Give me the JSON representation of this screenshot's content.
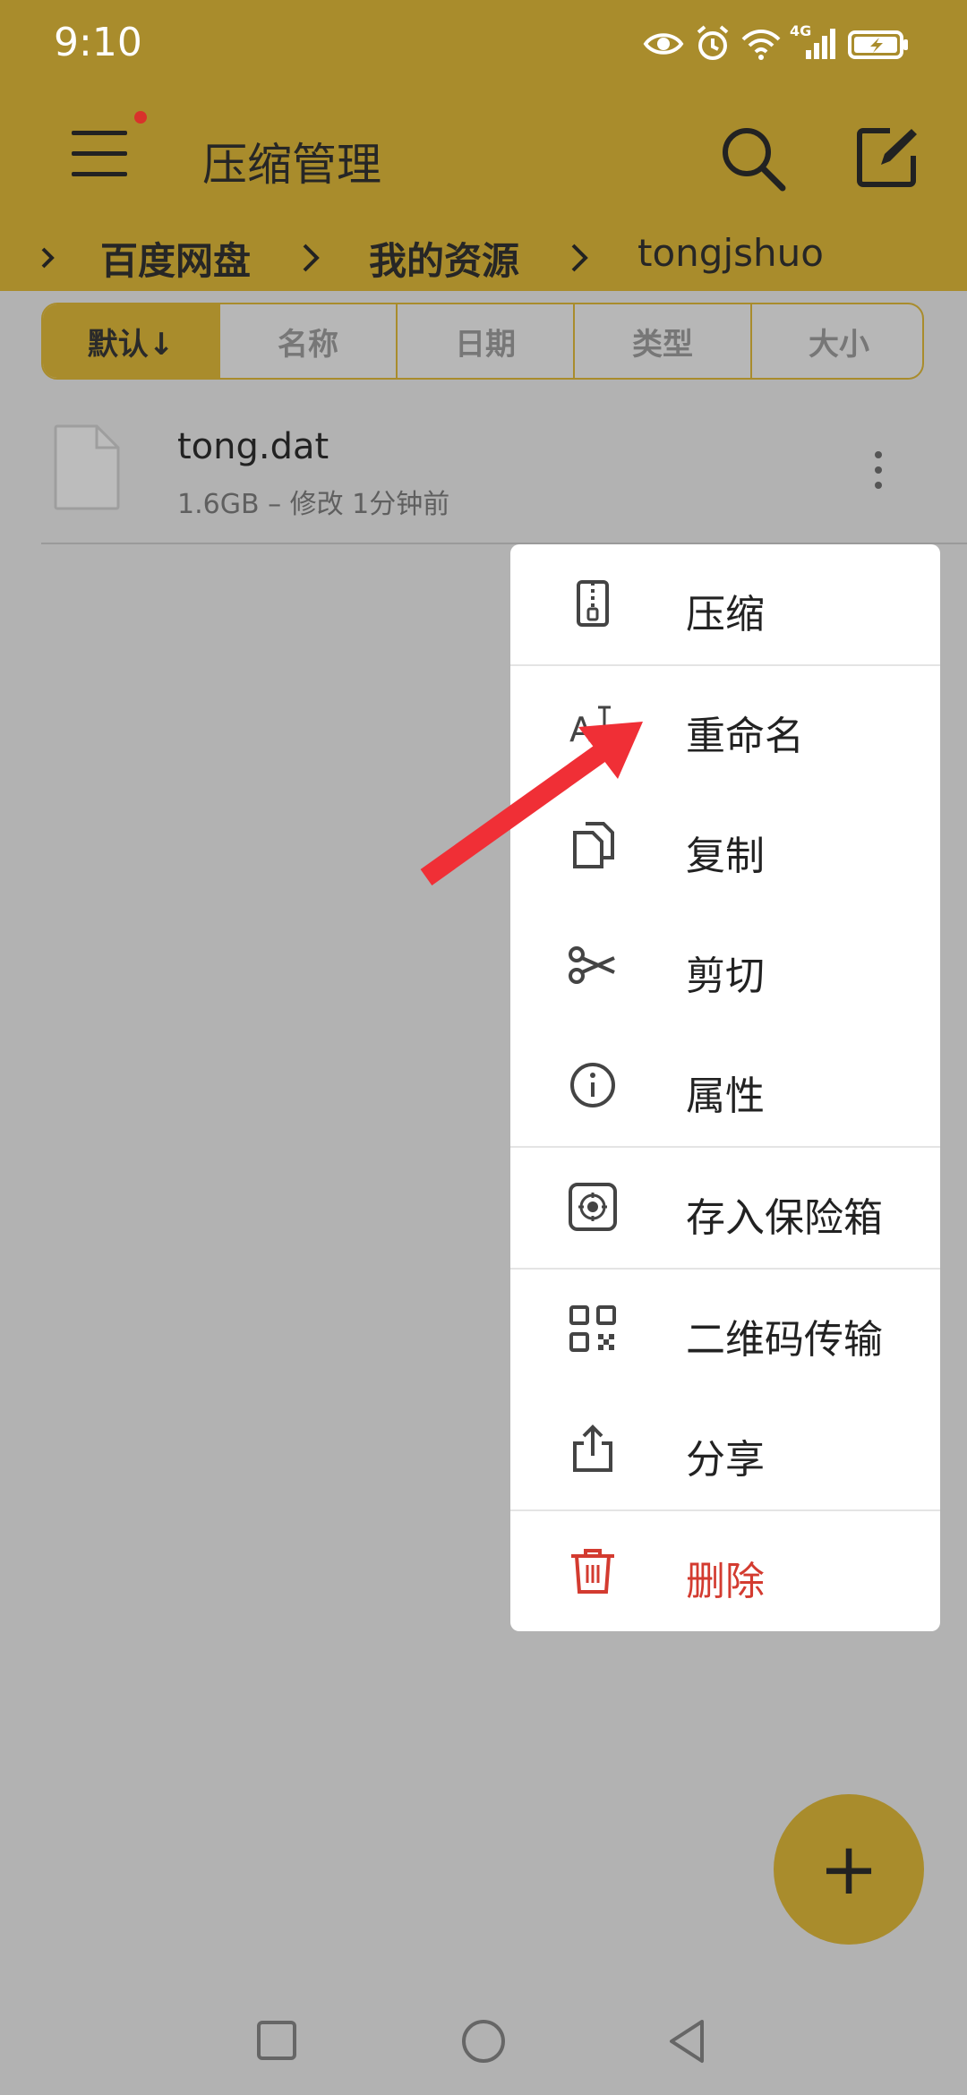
{
  "status_bar": {
    "time": "9:10",
    "icons": [
      "eye-icon",
      "alarm-icon",
      "wifi-icon",
      "signal-4g-icon",
      "battery-icon"
    ],
    "network_label": "4G"
  },
  "toolbar": {
    "title": "压缩管理",
    "icons": [
      "menu-icon",
      "search-icon",
      "edit-icon"
    ],
    "notification_dot_color": "#d9322b"
  },
  "breadcrumb": {
    "items": [
      "百度网盘",
      "我的资源",
      "tongjshuo"
    ]
  },
  "sort_tabs": [
    {
      "label": "默认↓",
      "active": true
    },
    {
      "label": "名称",
      "active": false
    },
    {
      "label": "日期",
      "active": false
    },
    {
      "label": "类型",
      "active": false
    },
    {
      "label": "大小",
      "active": false
    }
  ],
  "file": {
    "name": "tong.dat",
    "meta": "1.6GB – 修改 1分钟前"
  },
  "popup_menu": {
    "items": [
      {
        "label": "压缩",
        "icon": "zip-icon"
      },
      {
        "label": "重命名",
        "icon": "rename-icon"
      },
      {
        "label": "复制",
        "icon": "copy-icon"
      },
      {
        "label": "剪切",
        "icon": "scissors-icon"
      },
      {
        "label": "属性",
        "icon": "info-icon"
      },
      {
        "label": "存入保险箱",
        "icon": "safe-icon"
      },
      {
        "label": "二维码传输",
        "icon": "qr-code-icon"
      },
      {
        "label": "分享",
        "icon": "share-icon"
      },
      {
        "label": "删除",
        "icon": "trash-icon"
      }
    ]
  },
  "fab": {
    "label": "+"
  },
  "colors": {
    "accent": "#a98c2c",
    "background": "#b2b2b2",
    "danger": "#d33b30",
    "arrow": "#f02f36"
  }
}
